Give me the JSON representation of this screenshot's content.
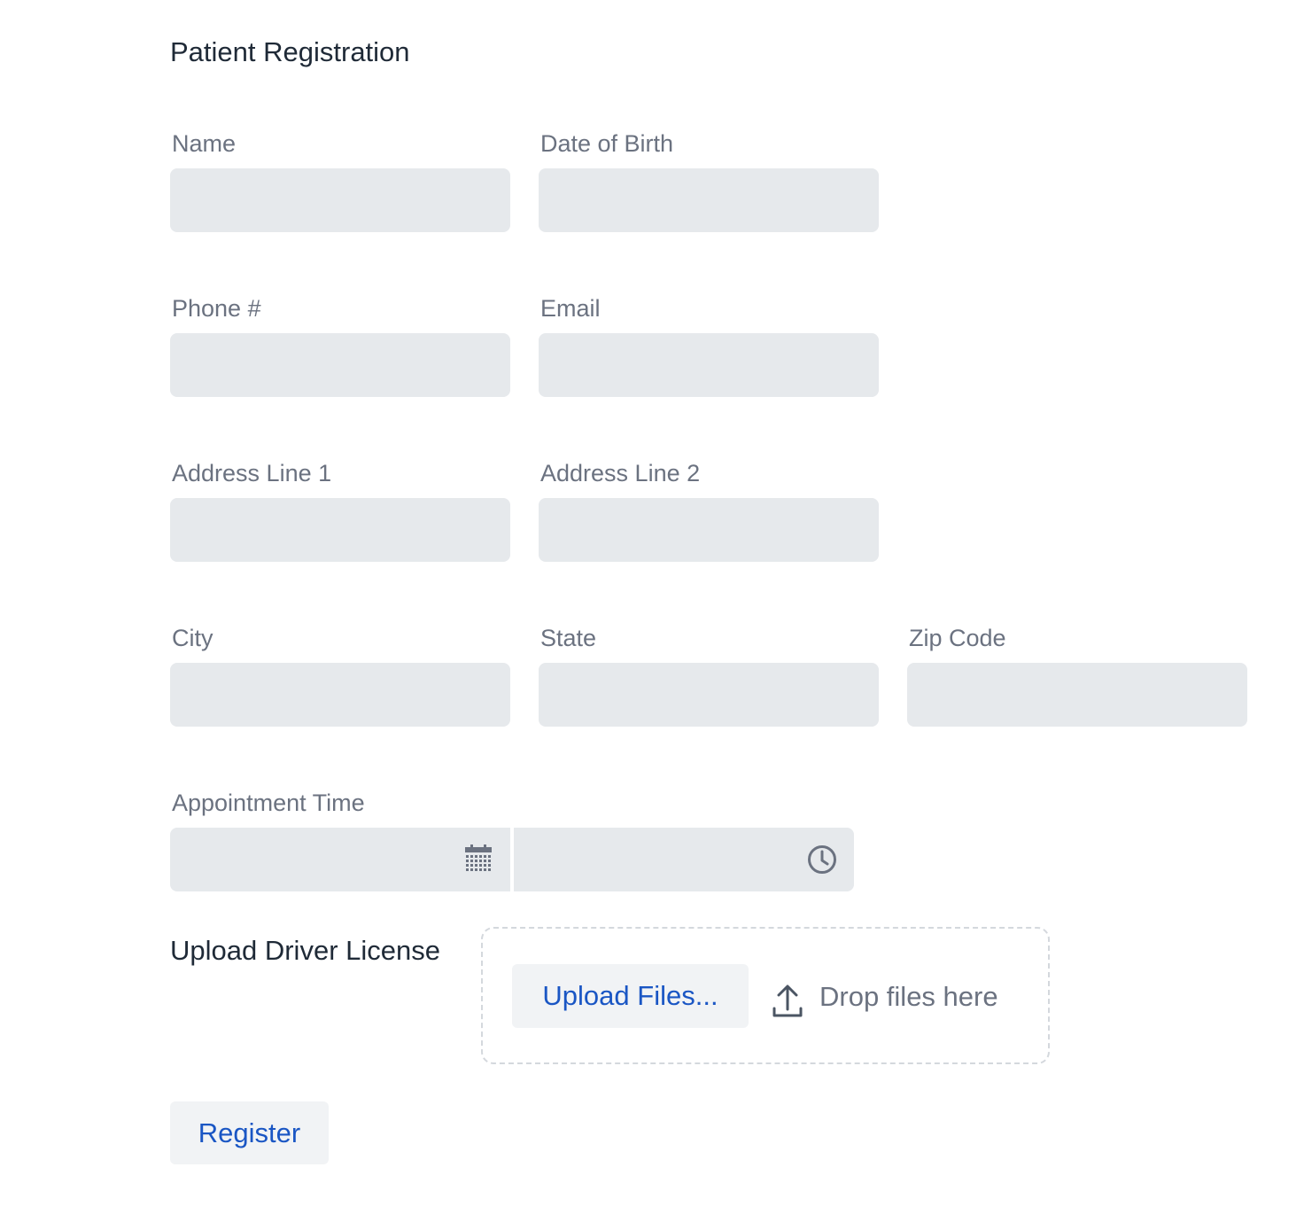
{
  "page": {
    "title": "Patient Registration"
  },
  "fields": {
    "name": {
      "label": "Name",
      "value": ""
    },
    "dob": {
      "label": "Date of Birth",
      "value": ""
    },
    "phone": {
      "label": "Phone #",
      "value": ""
    },
    "email": {
      "label": "Email",
      "value": ""
    },
    "address1": {
      "label": "Address Line 1",
      "value": ""
    },
    "address2": {
      "label": "Address Line 2",
      "value": ""
    },
    "city": {
      "label": "City",
      "value": ""
    },
    "state": {
      "label": "State",
      "value": ""
    },
    "zip": {
      "label": "Zip Code",
      "value": ""
    }
  },
  "appointment": {
    "label": "Appointment Time",
    "date_value": "",
    "time_value": "",
    "date_icon": "calendar-icon",
    "time_icon": "clock-icon"
  },
  "upload": {
    "label": "Upload Driver License",
    "button_label": "Upload Files...",
    "drop_text": "Drop files here",
    "icon": "upload-icon"
  },
  "actions": {
    "register_label": "Register"
  },
  "colors": {
    "input_bg": "#e6e9ec",
    "label": "#6b7280",
    "heading": "#1f2a37",
    "accent": "#1a56c4",
    "button_bg": "#f1f3f5",
    "icon": "#6b7280"
  }
}
